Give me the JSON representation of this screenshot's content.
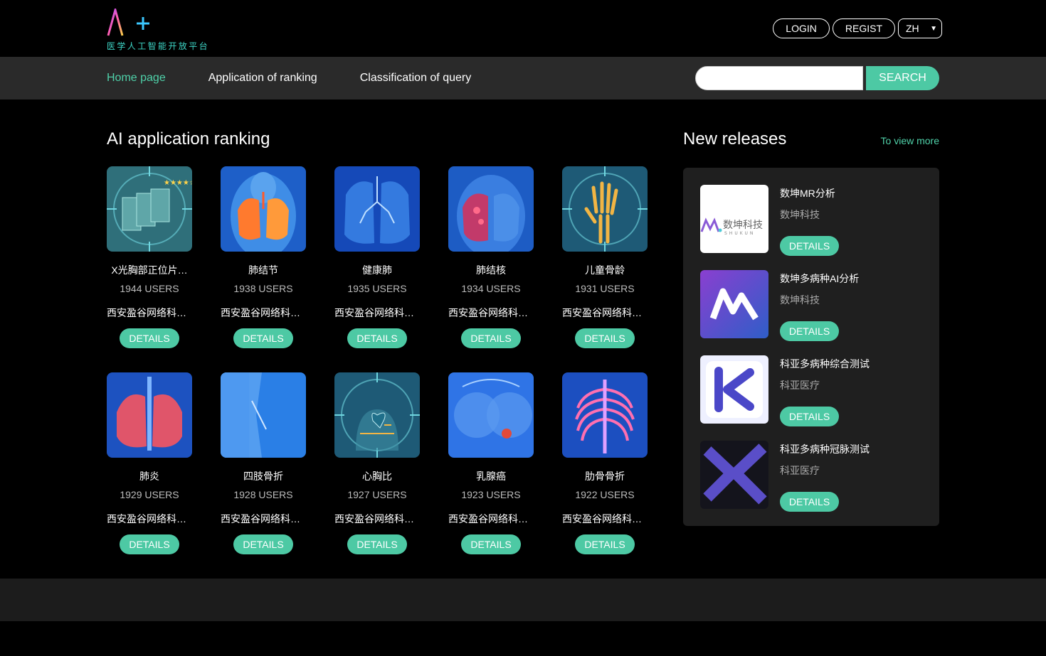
{
  "header": {
    "logo_text": "AI+",
    "logo_subtitle": "医学人工智能开放平台",
    "login_label": "LOGIN",
    "register_label": "REGIST",
    "language": "ZH"
  },
  "nav": {
    "items": [
      {
        "label": "Home page",
        "active": true
      },
      {
        "label": "Application of ranking",
        "active": false
      },
      {
        "label": "Classification of query",
        "active": false
      }
    ],
    "search_placeholder": "",
    "search_label": "SEARCH"
  },
  "ranking": {
    "title": "AI application ranking",
    "details_label": "DETAILS",
    "cards": [
      {
        "name": "X光胸部正位片…",
        "users": "1944 USERS",
        "company": "西安盈谷网络科…",
        "icon": "xray-films-icon"
      },
      {
        "name": "肺结节",
        "users": "1938 USERS",
        "company": "西安盈谷网络科…",
        "icon": "lung-nodule-icon"
      },
      {
        "name": "健康肺",
        "users": "1935 USERS",
        "company": "西安盈谷网络科…",
        "icon": "healthy-lung-icon"
      },
      {
        "name": "肺结核",
        "users": "1934 USERS",
        "company": "西安盈谷网络科…",
        "icon": "tuberculosis-icon"
      },
      {
        "name": "儿童骨龄",
        "users": "1931 USERS",
        "company": "西安盈谷网络科…",
        "icon": "hand-bone-icon"
      },
      {
        "name": "肺炎",
        "users": "1929 USERS",
        "company": "西安盈谷网络科…",
        "icon": "pneumonia-icon"
      },
      {
        "name": "四肢骨折",
        "users": "1928 USERS",
        "company": "西安盈谷网络科…",
        "icon": "limb-fracture-icon"
      },
      {
        "name": "心胸比",
        "users": "1927 USERS",
        "company": "西安盈谷网络科…",
        "icon": "cardiothoracic-ratio-icon"
      },
      {
        "name": "乳腺癌",
        "users": "1923 USERS",
        "company": "西安盈谷网络科…",
        "icon": "breast-cancer-icon"
      },
      {
        "name": "肋骨骨折",
        "users": "1922 USERS",
        "company": "西安盈谷网络科…",
        "icon": "rib-fracture-icon"
      }
    ]
  },
  "releases": {
    "title": "New releases",
    "view_more": "To view more",
    "details_label": "DETAILS",
    "items": [
      {
        "name": "数坤MR分析",
        "company": "数坤科技",
        "logo_text": "数坤科技",
        "logo_sub": "SHUKUN"
      },
      {
        "name": "数坤多病种AI分析",
        "company": "数坤科技"
      },
      {
        "name": "科亚多病种综合测试",
        "company": "科亚医疗"
      },
      {
        "name": "科亚多病种冠脉测试",
        "company": "科亚医疗"
      }
    ]
  },
  "colors": {
    "accent": "#4dc9a4",
    "nav_bg": "#2a2a2a",
    "panel_bg": "#1f1f1f"
  }
}
